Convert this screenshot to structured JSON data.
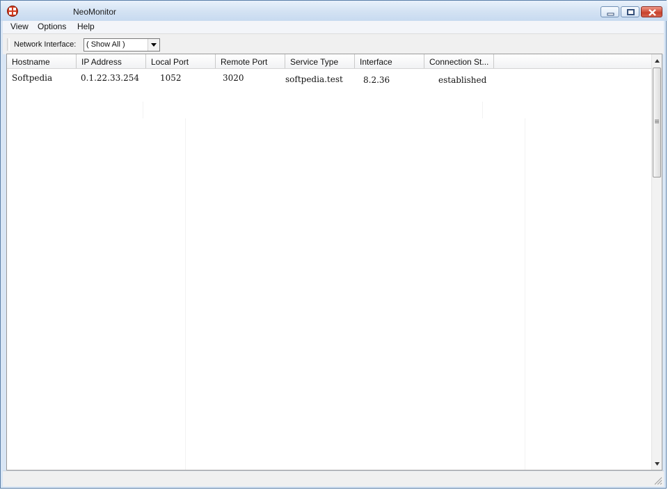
{
  "window": {
    "title": "NeoMonitor",
    "icon": "neomonitor-app-icon",
    "controls": [
      "minimize-icon",
      "restore-icon",
      "close-icon"
    ],
    "close_color": "#c8412c"
  },
  "menu": {
    "view": "View",
    "options": "Options",
    "help": "Help"
  },
  "toolbar": {
    "network_interface_label": "Network Interface:",
    "network_interface_value": "( Show All )"
  },
  "table": {
    "columns": [
      "Hostname",
      "IP Address",
      "Local Port",
      "Remote Port",
      "Service Type",
      "Interface",
      "Connection St..."
    ],
    "rows": [
      {
        "hostname": "Softpedia",
        "ip_address": "0.1.22.33.254",
        "local_port": "1052",
        "remote_port": "3020",
        "service_type": "softpedia.test",
        "interface": "8.2.36",
        "connection_state": "established"
      }
    ]
  }
}
